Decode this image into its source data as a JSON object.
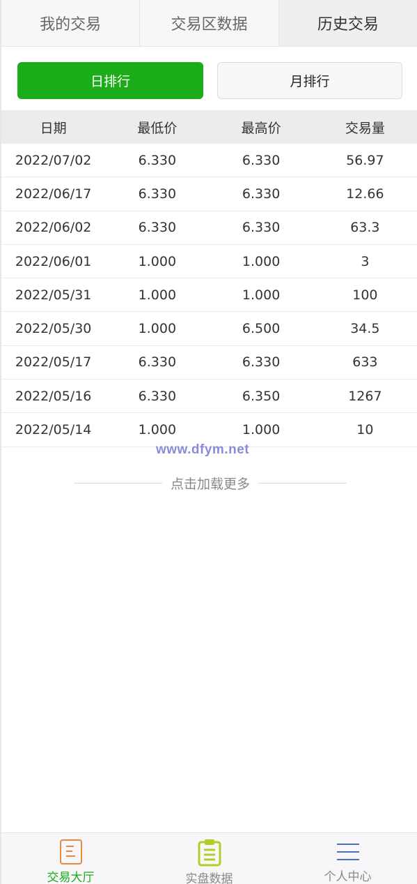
{
  "top_tabs": [
    {
      "label": "我的交易"
    },
    {
      "label": "交易区数据"
    },
    {
      "label": "历史交易"
    }
  ],
  "rank": {
    "day_label": "日排行",
    "month_label": "月排行"
  },
  "table": {
    "headers": [
      "日期",
      "最低价",
      "最高价",
      "交易量"
    ],
    "rows": [
      [
        "2022/07/02",
        "6.330",
        "6.330",
        "56.97"
      ],
      [
        "2022/06/17",
        "6.330",
        "6.330",
        "12.66"
      ],
      [
        "2022/06/02",
        "6.330",
        "6.330",
        "63.3"
      ],
      [
        "2022/06/01",
        "1.000",
        "1.000",
        "3"
      ],
      [
        "2022/05/31",
        "1.000",
        "1.000",
        "100"
      ],
      [
        "2022/05/30",
        "1.000",
        "6.500",
        "34.5"
      ],
      [
        "2022/05/17",
        "6.330",
        "6.330",
        "633"
      ],
      [
        "2022/05/16",
        "6.330",
        "6.350",
        "1267"
      ],
      [
        "2022/05/14",
        "1.000",
        "1.000",
        "10"
      ]
    ]
  },
  "watermark": "www.dfym.net",
  "load_more": "点击加载更多",
  "bottom_nav": [
    {
      "label": "交易大厅",
      "icon": "document-list-icon"
    },
    {
      "label": "实盘数据",
      "icon": "clipboard-icon"
    },
    {
      "label": "个人中心",
      "icon": "menu-lines-icon"
    }
  ],
  "colors": {
    "accent": "#1aad19",
    "icon_orange": "#e8883a",
    "icon_lime": "#b3cc2a",
    "icon_blue": "#4b6fb5"
  }
}
